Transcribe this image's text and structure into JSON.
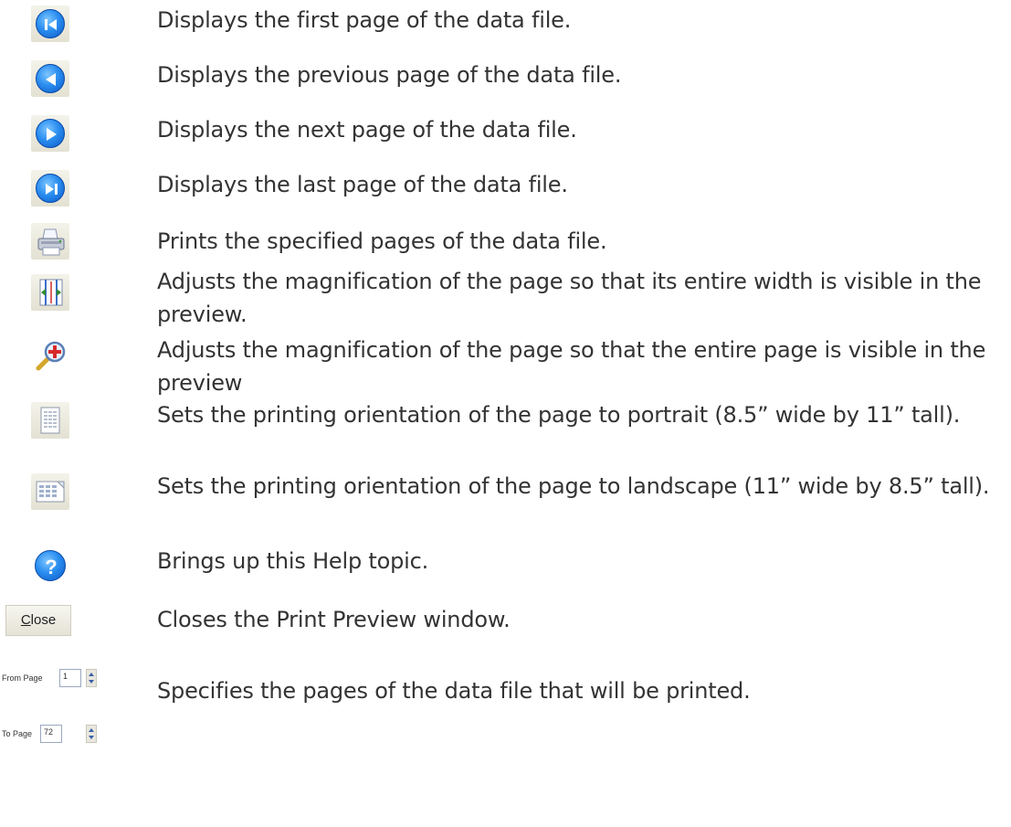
{
  "rows": [
    {
      "icon": "first-page-icon",
      "text": "Displays the first page of the data file."
    },
    {
      "icon": "previous-page-icon",
      "text": "Displays the previous page of the data file."
    },
    {
      "icon": "next-page-icon",
      "text": "Displays the next page of the data file."
    },
    {
      "icon": "last-page-icon",
      "text": "Displays the last page of the data file."
    },
    {
      "icon": "printer-icon",
      "text": "Prints the specified pages of the data file."
    },
    {
      "icon": "fit-width-icon",
      "text": "Adjusts the magnification of the page so that its entire width is visible in the preview."
    },
    {
      "icon": "zoom-fit-page-icon",
      "text": "Adjusts the magnification of the page so that the entire page is visible in the preview"
    },
    {
      "icon": "portrait-icon",
      "text": "Sets the printing orientation of the page to portrait (8.5” wide by 11” tall)."
    },
    {
      "icon": "landscape-icon",
      "text": "Sets the printing orientation of the page to landscape (11” wide by 8.5” tall)."
    },
    {
      "icon": "help-icon",
      "text": "Brings up this Help topic."
    },
    {
      "icon": "close-button",
      "text": "Closes the Print Preview window."
    },
    {
      "icon": "page-range-spinners",
      "text": "Specifies the pages of the data file that will be printed."
    }
  ],
  "close_button": {
    "label": "Close",
    "accesskey": "C"
  },
  "page_range": {
    "from_label": "From Page",
    "from_value": "1",
    "to_label": "To Page",
    "to_value": "72"
  },
  "colors": {
    "text": "#333333",
    "icon_blue": "#1a74e0",
    "tile": "#ece9d8"
  }
}
